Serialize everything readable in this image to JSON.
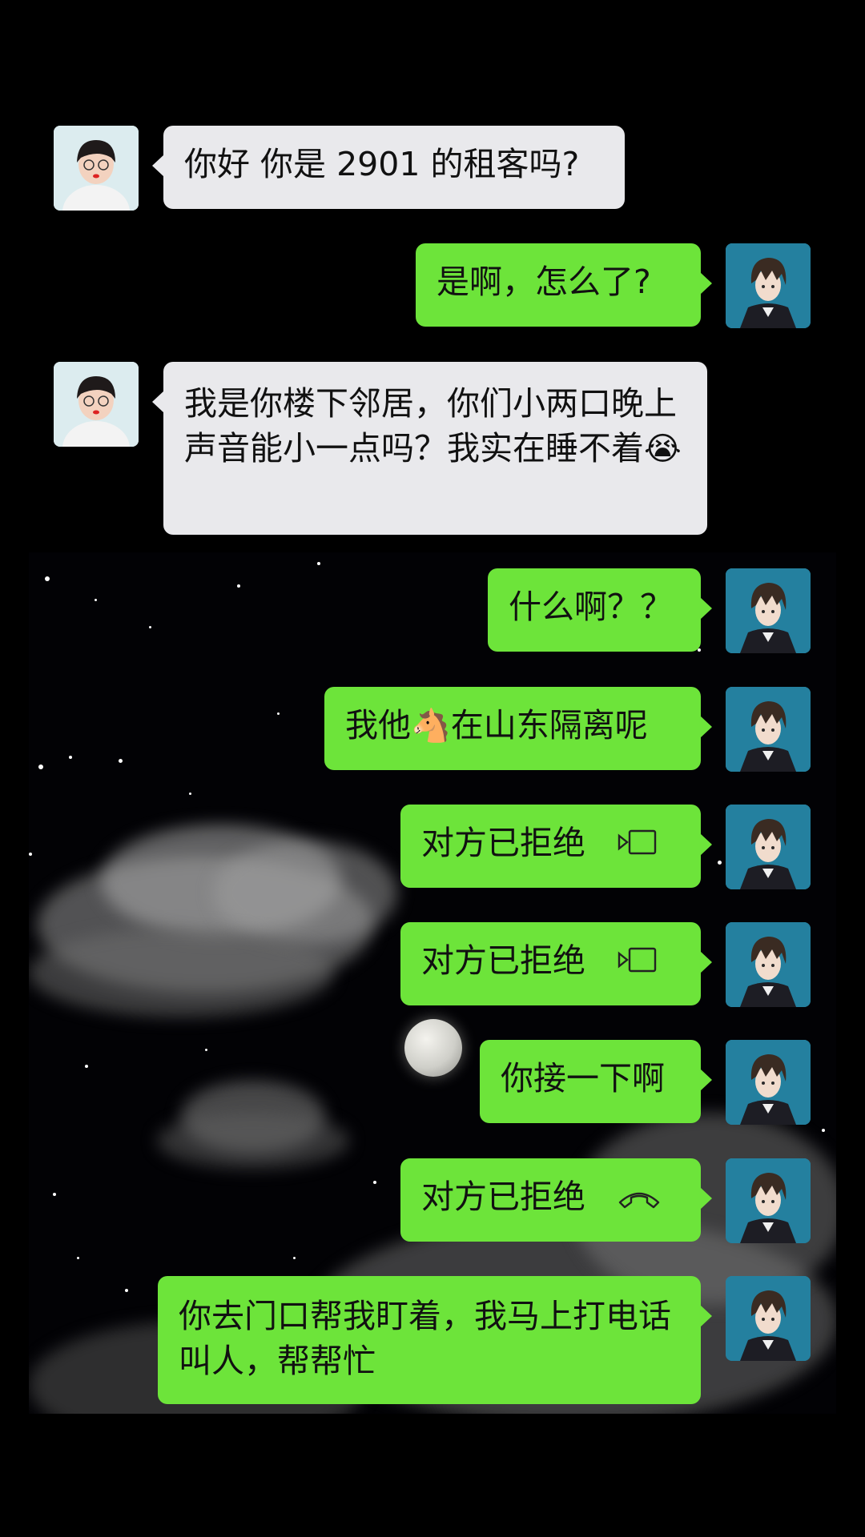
{
  "conversation": {
    "messages": [
      {
        "sender": "neighbor",
        "text": "你好 你是 2901 的租客吗?"
      },
      {
        "sender": "me",
        "text": "是啊，怎么了?"
      },
      {
        "sender": "neighbor",
        "text": "我是你楼下邻居，你们小两口晚上声音能小一点吗？我实在睡不着",
        "emoji": "😭"
      },
      {
        "sender": "me",
        "text": "什么啊？？"
      },
      {
        "sender": "me",
        "text_before": "我他",
        "emoji": "🐴",
        "text_after": "在山东隔离呢"
      },
      {
        "sender": "me",
        "text": "对方已拒绝",
        "icon": "video-call-icon"
      },
      {
        "sender": "me",
        "text": "对方已拒绝",
        "icon": "video-call-icon"
      },
      {
        "sender": "me",
        "text": "你接一下啊"
      },
      {
        "sender": "me",
        "text": "对方已拒绝",
        "icon": "phone-icon"
      },
      {
        "sender": "me",
        "text": "你去门口帮我盯着，我马上打电话叫人，帮帮忙"
      }
    ]
  },
  "colors": {
    "incoming_bubble": "#e9e9ec",
    "outgoing_bubble": "#6de43a",
    "background": "#000000"
  }
}
